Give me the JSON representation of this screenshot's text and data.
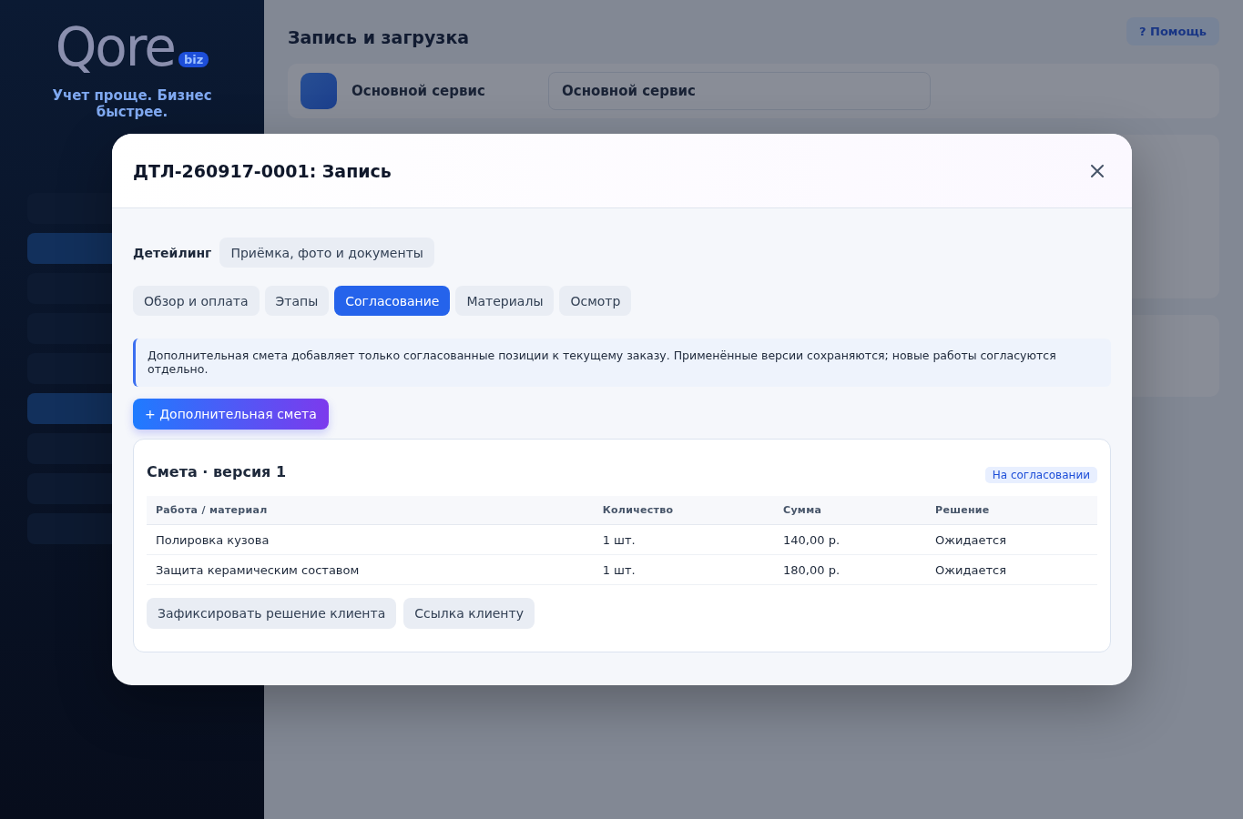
{
  "background": {
    "logo": "Qore",
    "logo_suffix": "biz",
    "tagline": "Учет проще. Бизнес быстрее.",
    "page_title": "Запись и загрузка",
    "help_button": "? Помощь",
    "location_name": "Основной сервис",
    "location_select": "Основной сервис"
  },
  "modal": {
    "title": "ДТЛ-260917-0001: Запись",
    "section_label": "Детейлинг",
    "section_link": "Приёмка, фото и документы",
    "tabs": [
      {
        "label": "Обзор и оплата",
        "selected": false
      },
      {
        "label": "Этапы",
        "selected": false
      },
      {
        "label": "Согласование",
        "selected": true
      },
      {
        "label": "Материалы",
        "selected": false
      },
      {
        "label": "Осмотр",
        "selected": false
      }
    ],
    "notice": "Дополнительная смета добавляет только согласованные позиции к текущему заказу. Применённые версии сохраняются; новые работы согласуются отдельно.",
    "add_button": "+ Дополнительная смета",
    "estimate": {
      "title": "Смета · версия 1",
      "status": "На согласовании",
      "columns": [
        "Работа / материал",
        "Количество",
        "Сумма",
        "Решение"
      ],
      "rows": [
        [
          "Полировка кузова",
          "1 шт.",
          "140,00 р.",
          "Ожидается"
        ],
        [
          "Защита керамическим составом",
          "1 шт.",
          "180,00 р.",
          "Ожидается"
        ]
      ],
      "actions": [
        "Зафиксировать решение клиента",
        "Ссылка клиенту"
      ]
    }
  }
}
